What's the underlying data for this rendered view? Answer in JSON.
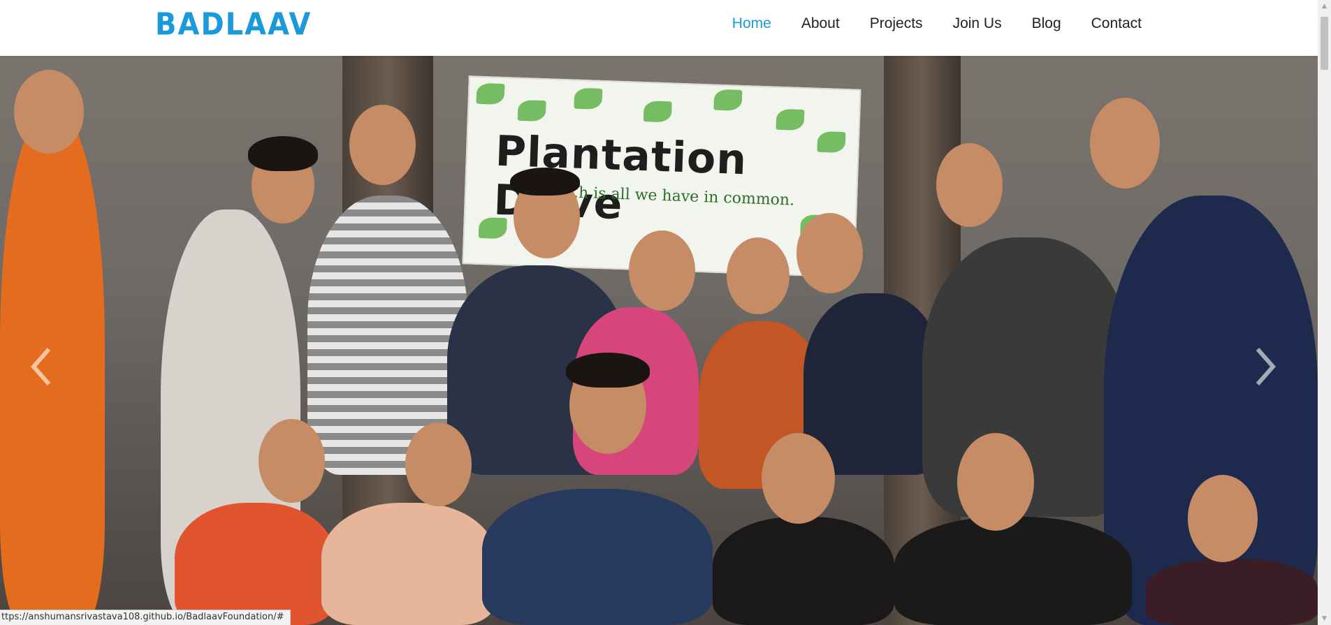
{
  "brand": {
    "name": "BADLAAV"
  },
  "nav": {
    "items": [
      {
        "label": "Home",
        "active": true
      },
      {
        "label": "About",
        "active": false
      },
      {
        "label": "Projects",
        "active": false
      },
      {
        "label": "Join Us",
        "active": false
      },
      {
        "label": "Blog",
        "active": false
      },
      {
        "label": "Contact",
        "active": false
      }
    ]
  },
  "hero": {
    "banner_title": "Plantation Drive",
    "banner_subtitle": "...h is all we have in common.",
    "prev_icon": "chevron-left-icon",
    "next_icon": "chevron-right-icon"
  },
  "status_bar": {
    "url": "ttps://anshumansrivastava108.github.io/BadlaavFoundation/#"
  },
  "colors": {
    "accent": "#1a9ad9",
    "text": "#222222"
  }
}
